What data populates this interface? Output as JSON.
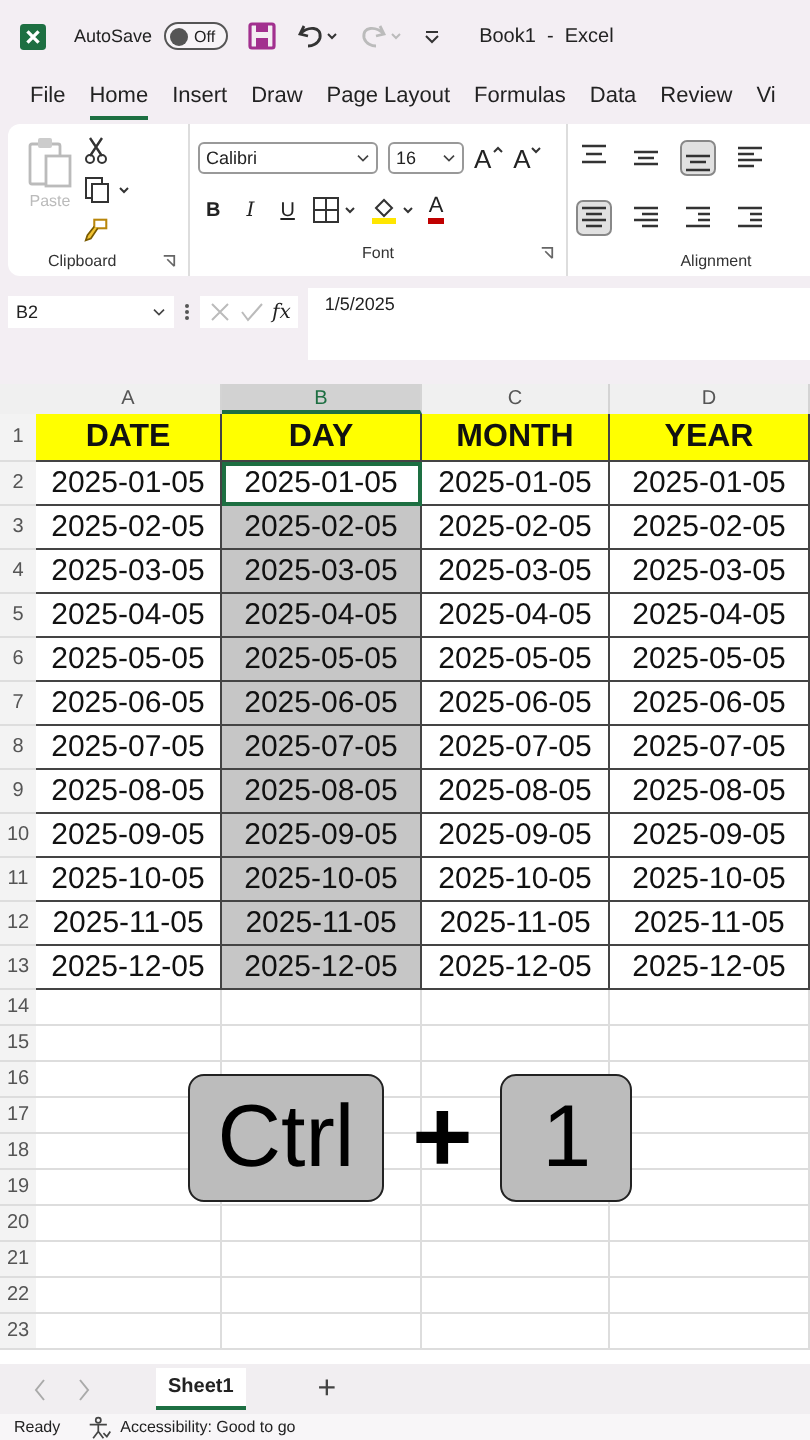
{
  "title_bar": {
    "autosave_label": "AutoSave",
    "autosave": {
      "on": false,
      "label": "Off"
    },
    "title": "Book1  -  Excel"
  },
  "tabs": [
    {
      "label": "File",
      "selected": false
    },
    {
      "label": "Home",
      "selected": true
    },
    {
      "label": "Insert",
      "selected": false
    },
    {
      "label": "Draw",
      "selected": false
    },
    {
      "label": "Page Layout",
      "selected": false
    },
    {
      "label": "Formulas",
      "selected": false
    },
    {
      "label": "Data",
      "selected": false
    },
    {
      "label": "Review",
      "selected": false
    },
    {
      "label": "Vi",
      "selected": false
    }
  ],
  "ribbon": {
    "clipboard": {
      "paste_label": "Paste",
      "paste_disabled": true,
      "group_label": "Clipboard"
    },
    "font": {
      "font_name": "Calibri",
      "font_size": "16",
      "grow": "A",
      "shrink": "A",
      "bold": "B",
      "italic": "I",
      "underline": "U",
      "font_color": "A",
      "group_label": "Font"
    },
    "alignment": {
      "buttons": [
        {
          "kind": "top",
          "selected": false
        },
        {
          "kind": "middle",
          "selected": false
        },
        {
          "kind": "bottom",
          "selected": true
        },
        {
          "kind": "left",
          "selected": false
        },
        {
          "kind": "center",
          "selected": true
        },
        {
          "kind": "right",
          "selected": false
        },
        {
          "kind": "outdent",
          "selected": false
        },
        {
          "kind": "indent",
          "selected": false
        }
      ],
      "group_label": "Alignment"
    }
  },
  "formula_bar": {
    "name_box": "B2",
    "fx": "fx",
    "value": "1/5/2025"
  },
  "columns": [
    {
      "label": "A",
      "selected": false
    },
    {
      "label": "B",
      "selected": true
    },
    {
      "label": "C",
      "selected": false
    },
    {
      "label": "D",
      "selected": false
    }
  ],
  "rows": [
    {
      "number": "1",
      "kind": "header",
      "active": false,
      "cells": [
        "DATE",
        "DAY",
        "MONTH",
        "YEAR"
      ]
    },
    {
      "number": "2",
      "kind": "data",
      "active": true,
      "cells": [
        "2025-01-05",
        "2025-01-05",
        "2025-01-05",
        "2025-01-05"
      ]
    },
    {
      "number": "3",
      "kind": "data",
      "active": false,
      "cells": [
        "2025-02-05",
        "2025-02-05",
        "2025-02-05",
        "2025-02-05"
      ]
    },
    {
      "number": "4",
      "kind": "data",
      "active": false,
      "cells": [
        "2025-03-05",
        "2025-03-05",
        "2025-03-05",
        "2025-03-05"
      ]
    },
    {
      "number": "5",
      "kind": "data",
      "active": false,
      "cells": [
        "2025-04-05",
        "2025-04-05",
        "2025-04-05",
        "2025-04-05"
      ]
    },
    {
      "number": "6",
      "kind": "data",
      "active": false,
      "cells": [
        "2025-05-05",
        "2025-05-05",
        "2025-05-05",
        "2025-05-05"
      ]
    },
    {
      "number": "7",
      "kind": "data",
      "active": false,
      "cells": [
        "2025-06-05",
        "2025-06-05",
        "2025-06-05",
        "2025-06-05"
      ]
    },
    {
      "number": "8",
      "kind": "data",
      "active": false,
      "cells": [
        "2025-07-05",
        "2025-07-05",
        "2025-07-05",
        "2025-07-05"
      ]
    },
    {
      "number": "9",
      "kind": "data",
      "active": false,
      "cells": [
        "2025-08-05",
        "2025-08-05",
        "2025-08-05",
        "2025-08-05"
      ]
    },
    {
      "number": "10",
      "kind": "data",
      "active": false,
      "cells": [
        "2025-09-05",
        "2025-09-05",
        "2025-09-05",
        "2025-09-05"
      ]
    },
    {
      "number": "11",
      "kind": "data",
      "active": false,
      "cells": [
        "2025-10-05",
        "2025-10-05",
        "2025-10-05",
        "2025-10-05"
      ]
    },
    {
      "number": "12",
      "kind": "data",
      "active": false,
      "cells": [
        "2025-11-05",
        "2025-11-05",
        "2025-11-05",
        "2025-11-05"
      ]
    },
    {
      "number": "13",
      "kind": "data",
      "active": false,
      "cells": [
        "2025-12-05",
        "2025-12-05",
        "2025-12-05",
        "2025-12-05"
      ]
    }
  ],
  "empty_rows": [
    "14",
    "15",
    "16",
    "17",
    "18",
    "19",
    "20",
    "21",
    "22",
    "23"
  ],
  "overlay_keys": [
    {
      "kind": "key",
      "label": "Ctrl"
    },
    {
      "kind": "plus",
      "label": "+"
    },
    {
      "kind": "key",
      "label": "1"
    }
  ],
  "sheet_tabs": [
    {
      "label": "Sheet1",
      "selected": true
    }
  ],
  "add_sheet": "+",
  "status_bar": {
    "mode": "Ready",
    "accessibility": "Accessibility: Good to go"
  }
}
